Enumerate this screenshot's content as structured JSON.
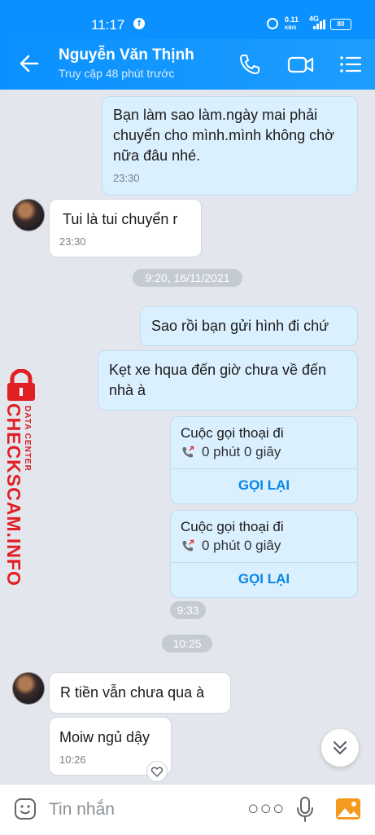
{
  "status_bar": {
    "time": "11:17",
    "net_speed_top": "0.11",
    "net_speed_unit": "KB/S",
    "signal": "4G",
    "battery": "80"
  },
  "header": {
    "name": "Nguyễn Văn Thịnh",
    "subtitle": "Truy cập 48 phút trước"
  },
  "messages": [
    {
      "from": "me",
      "text": "Bạn làm sao làm.ngày mai phải chuyển cho mình.mình không chờ nữa đâu nhé.",
      "time": "23:30"
    },
    {
      "from": "other",
      "text": "Tui là tui chuyển r",
      "time": "23:30"
    },
    {
      "from": "me",
      "text": "Sao rồi bạn gửi hình đi chứ"
    },
    {
      "from": "me",
      "text": "Kẹt xe hqua đến giờ chưa về đến nhà à"
    },
    {
      "from": "other",
      "text": "R tiền vẫn chưa qua à"
    },
    {
      "from": "other",
      "text": "Moiw ngủ dậy",
      "time": "10:26"
    }
  ],
  "separators": [
    "9:20, 16/11/2021",
    "10:25"
  ],
  "calls": [
    {
      "title": "Cuộc gọi thoại đi",
      "duration": "0 phút 0 giây",
      "action": "GỌI LẠI"
    },
    {
      "title": "Cuộc gọi thoại đi",
      "duration": "0 phút 0 giây",
      "action": "GỌI LẠI"
    }
  ],
  "calls_time": "9:33",
  "watermark": {
    "main": "CHECKSCAM.INFO",
    "sub": "DATA CENTER"
  },
  "composer": {
    "placeholder": "Tin nhắn"
  },
  "colors": {
    "brand": "#0a91ff",
    "me_bubble": "#dbf0ff",
    "background": "#e3e6ec",
    "watermark": "#e02025"
  },
  "icons": [
    "back-arrow-icon",
    "phone-icon",
    "video-icon",
    "menu-icon",
    "emoji-icon",
    "more-icon",
    "mic-icon",
    "image-icon",
    "chevron-down-icon",
    "heart-icon"
  ]
}
